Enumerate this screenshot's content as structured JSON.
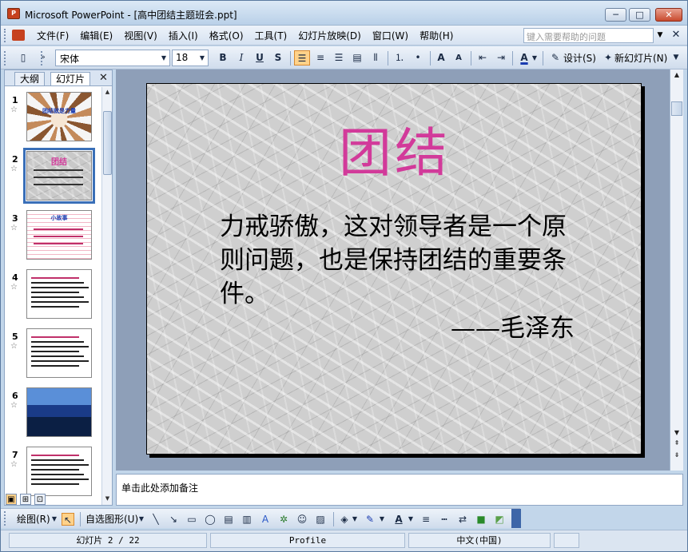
{
  "window": {
    "title": "Microsoft PowerPoint - [高中团结主题班会.ppt]",
    "minimize_glyph": "─",
    "maximize_glyph": "□",
    "close_glyph": "✕"
  },
  "menubar": {
    "items": [
      "文件(F)",
      "编辑(E)",
      "视图(V)",
      "插入(I)",
      "格式(O)",
      "工具(T)",
      "幻灯片放映(D)",
      "窗口(W)",
      "帮助(H)"
    ],
    "help_placeholder": "键入需要帮助的问题",
    "close_glyph": "✕"
  },
  "toolbar": {
    "font_name": "宋体",
    "font_size": "18",
    "bold": "B",
    "italic": "I",
    "underline": "U",
    "shadow": "S",
    "design_label": "设计(S)",
    "new_slide_label": "新幻灯片(N)"
  },
  "left_pane": {
    "tab_outline": "大纲",
    "tab_slides": "幻灯片",
    "close_glyph": "✕",
    "thumbnails": [
      {
        "num": "1",
        "style": "hands",
        "title": "团结就是力量"
      },
      {
        "num": "2",
        "style": "marble",
        "title": "团结"
      },
      {
        "num": "3",
        "style": "paperline",
        "title": "小故事"
      },
      {
        "num": "4",
        "style": "textblock",
        "title": ""
      },
      {
        "num": "5",
        "style": "textblock",
        "title": ""
      },
      {
        "num": "6",
        "style": "seascape",
        "title": ""
      },
      {
        "num": "7",
        "style": "textblock",
        "title": ""
      }
    ],
    "selected_index": 1
  },
  "slide": {
    "title": "团结",
    "body": "力戒骄傲，这对领导者是一个原则问题，也是保持团结的重要条件。",
    "author": "——毛泽东"
  },
  "notes": {
    "placeholder": "单击此处添加备注"
  },
  "drawbar": {
    "draw_label": "绘图(R)",
    "autoshapes_label": "自选图形(U)"
  },
  "status": {
    "slide_position": "幻灯片 2 / 22",
    "design_template": "Profile",
    "language": "中文(中国)"
  }
}
